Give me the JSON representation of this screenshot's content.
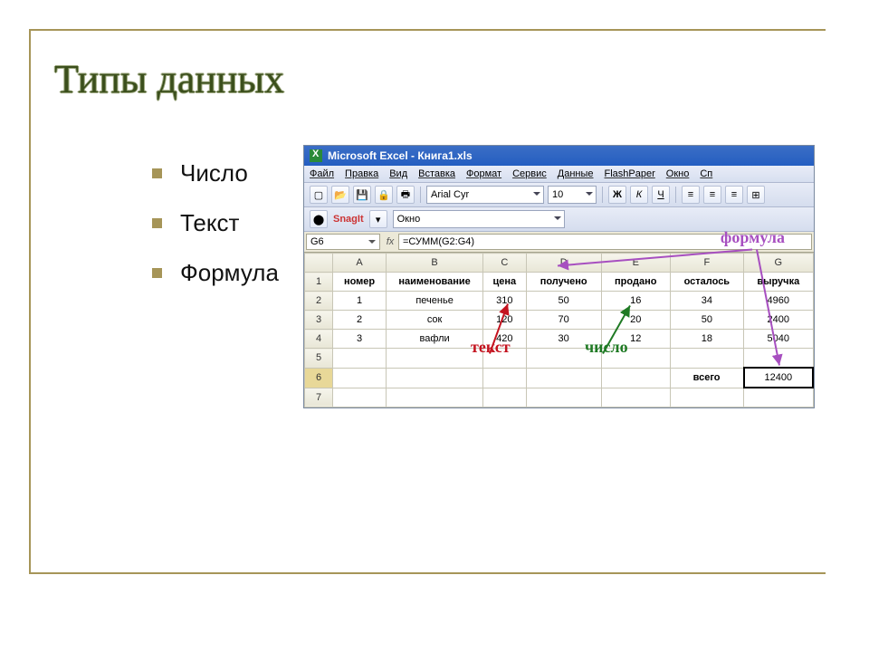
{
  "slide_title": "Типы данных",
  "bullets": [
    "Число",
    "Текст",
    "Формула"
  ],
  "excel": {
    "title": "Microsoft Excel - Книга1.xls",
    "menu": [
      "Файл",
      "Правка",
      "Вид",
      "Вставка",
      "Формат",
      "Сервис",
      "Данные",
      "FlashPaper",
      "Окно",
      "Сп"
    ],
    "font_name": "Arial Cyr",
    "font_size": "10",
    "snagit_label": "SnagIt",
    "snagit_combo": "Окно",
    "cell_ref": "G6",
    "formula": "=СУММ(G2:G4)",
    "col_letters": [
      "",
      "A",
      "B",
      "C",
      "D",
      "E",
      "F",
      "G"
    ],
    "table": {
      "headers": [
        "номер",
        "наименование",
        "цена",
        "получено",
        "продано",
        "осталось",
        "выручка"
      ],
      "rows": [
        [
          "1",
          "печенье",
          "310",
          "50",
          "16",
          "34",
          "4960"
        ],
        [
          "2",
          "сок",
          "120",
          "70",
          "20",
          "50",
          "2400"
        ],
        [
          "3",
          "вафли",
          "420",
          "30",
          "12",
          "18",
          "5040"
        ]
      ],
      "total_label": "всего",
      "total_value": "12400"
    }
  },
  "annotations": {
    "formula": "формула",
    "text": "текст",
    "number": "число"
  },
  "chart_data": {
    "type": "table",
    "title": "Типы данных",
    "columns": [
      "номер",
      "наименование",
      "цена",
      "получено",
      "продано",
      "осталось",
      "выручка"
    ],
    "rows": [
      [
        1,
        "печенье",
        310,
        50,
        16,
        34,
        4960
      ],
      [
        2,
        "сок",
        120,
        70,
        20,
        50,
        2400
      ],
      [
        3,
        "вафли",
        420,
        30,
        12,
        18,
        5040
      ]
    ],
    "totals": {
      "выручка": 12400
    },
    "formula_cell": {
      "ref": "G6",
      "formula": "=СУММ(G2:G4)",
      "value": 12400
    }
  }
}
